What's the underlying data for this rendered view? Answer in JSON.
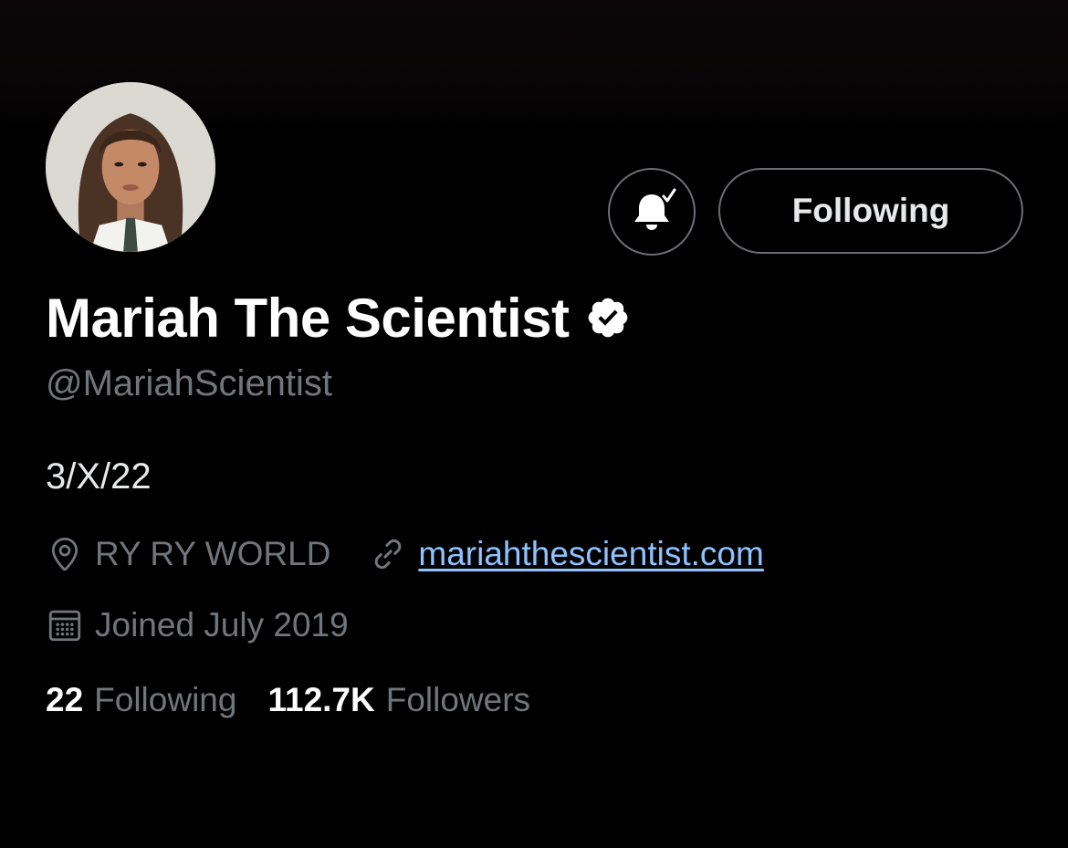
{
  "profile": {
    "display_name": "Mariah The Scientist",
    "handle": "@MariahScientist",
    "bio": "3/X/22",
    "location": "RY RY WORLD",
    "website": "mariahthescientist.com",
    "joined": "Joined July 2019",
    "verified": true
  },
  "actions": {
    "follow_state_label": "Following",
    "notifications_icon": "bell-check-icon"
  },
  "stats": {
    "following_count": "22",
    "following_label": "Following",
    "followers_count": "112.7K",
    "followers_label": "Followers"
  },
  "icons": {
    "verified": "verified-badge-icon",
    "location": "location-pin-icon",
    "link": "link-icon",
    "calendar": "calendar-icon"
  },
  "colors": {
    "background": "#000000",
    "text_primary": "#e7e9ea",
    "text_secondary": "#71767b",
    "link": "#8ec3ff",
    "button_border": "#6b6f74"
  }
}
